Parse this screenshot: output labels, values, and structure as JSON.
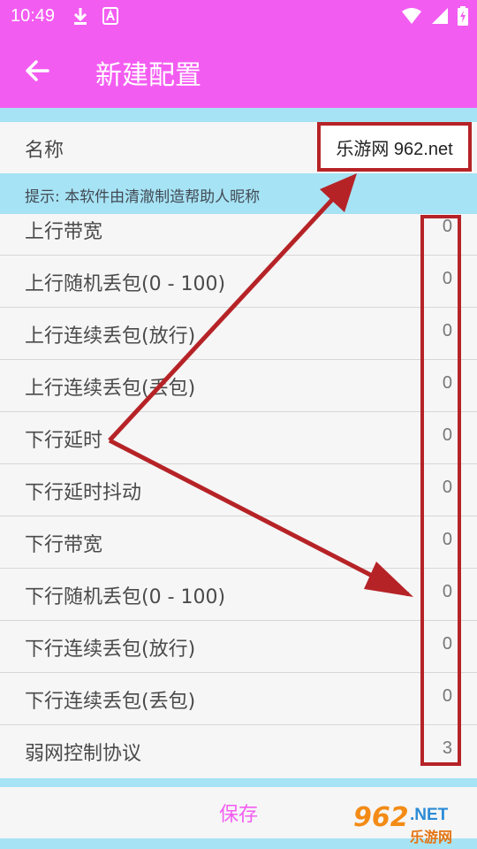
{
  "status_bar": {
    "time": "10:49",
    "icons": [
      "download-icon",
      "accessibility-icon",
      "wifi-icon",
      "signal-icon",
      "battery-charging-icon"
    ]
  },
  "app_bar": {
    "title": "新建配置",
    "back_icon": "arrow-left-icon"
  },
  "form": {
    "name_label": "名称",
    "name_value": "乐游网 962.net",
    "hint": "提示: 本软件由清澈制造帮助人昵称",
    "fields": [
      {
        "label": "上行带宽",
        "value": "0"
      },
      {
        "label": "上行随机丢包(0 - 100)",
        "value": "0"
      },
      {
        "label": "上行连续丢包(放行)",
        "value": "0"
      },
      {
        "label": "上行连续丢包(丢包)",
        "value": "0"
      },
      {
        "label": "下行延时",
        "value": "0"
      },
      {
        "label": "下行延时抖动",
        "value": "0"
      },
      {
        "label": "下行带宽",
        "value": "0"
      },
      {
        "label": "下行随机丢包(0 - 100)",
        "value": "0"
      },
      {
        "label": "下行连续丢包(放行)",
        "value": "0"
      },
      {
        "label": "下行连续丢包(丢包)",
        "value": "0"
      },
      {
        "label": "弱网控制协议",
        "value": "3"
      }
    ],
    "save_label": "保存"
  },
  "watermark": {
    "number": "962",
    "domain": ".NET",
    "site": "乐游网"
  },
  "colors": {
    "accent": "#f35cf1",
    "strip": "#a6e3f4",
    "annotation": "#b62327"
  }
}
